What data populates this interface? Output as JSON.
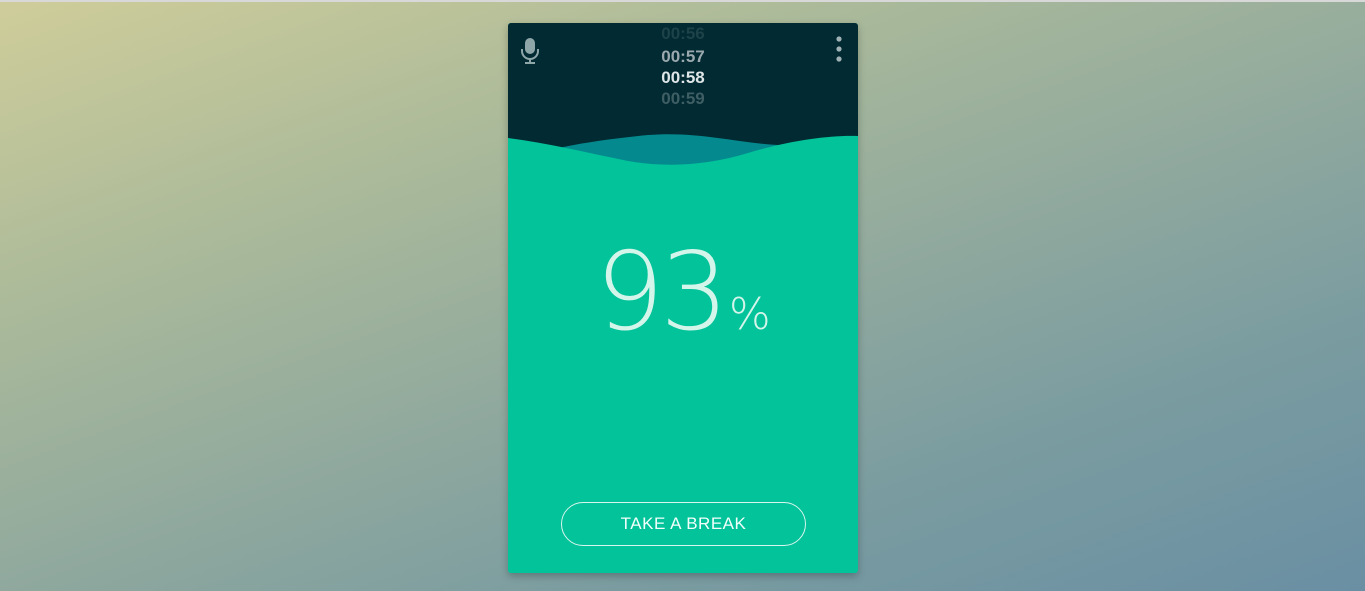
{
  "timer": {
    "items": [
      "00:56",
      "00:57",
      "00:58",
      "00:59"
    ]
  },
  "progress": {
    "value": "93",
    "unit": "%"
  },
  "actions": {
    "break_label": "TAKE A BREAK"
  },
  "icons": {
    "left": "microphone-icon",
    "right": "more-vertical-icon"
  },
  "colors": {
    "header": "#022a33",
    "water": "#02c39a",
    "wave_back": "#048a8e",
    "text_light": "#d4f5ea"
  }
}
